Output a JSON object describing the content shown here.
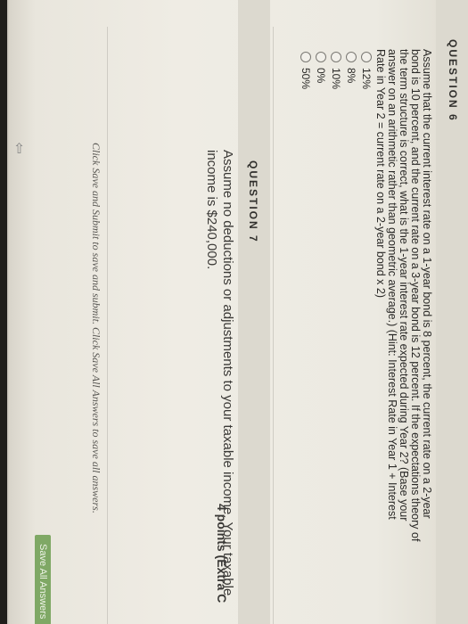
{
  "q6": {
    "title": "QUESTION 6",
    "lines": [
      "Assume that the current interest rate on a 1-year bond is 8 percent, the current rate on a 2-year",
      "bond is 10 percent, and the current rate on a 3-year bond is 12 percent. If the expectations theory of",
      "the term structure is correct, what is the 1-year interest rate expected during Year 2? (Base your",
      "answer on an arithmetic rather than geometric average.) (Hint: Interest Rate in Year 1 + Interest",
      "Rate in Year 2 = current rate on a 2-year bond x 2)"
    ],
    "options": [
      "12%",
      "8%",
      "10%",
      "0%",
      "50%"
    ]
  },
  "q7": {
    "title": "QUESTION 7",
    "points": "4 points (Extra C",
    "lines": [
      "Assume no deductions or adjustments to your taxable income. Your taxable",
      "income is $240,000."
    ]
  },
  "footer": {
    "instructions": "Click Save and Submit to save and submit. Click Save All Answers to save all answers.",
    "save_all": "Save All Answers"
  },
  "icons": {
    "cursor": "cursor-arrow-icon"
  }
}
